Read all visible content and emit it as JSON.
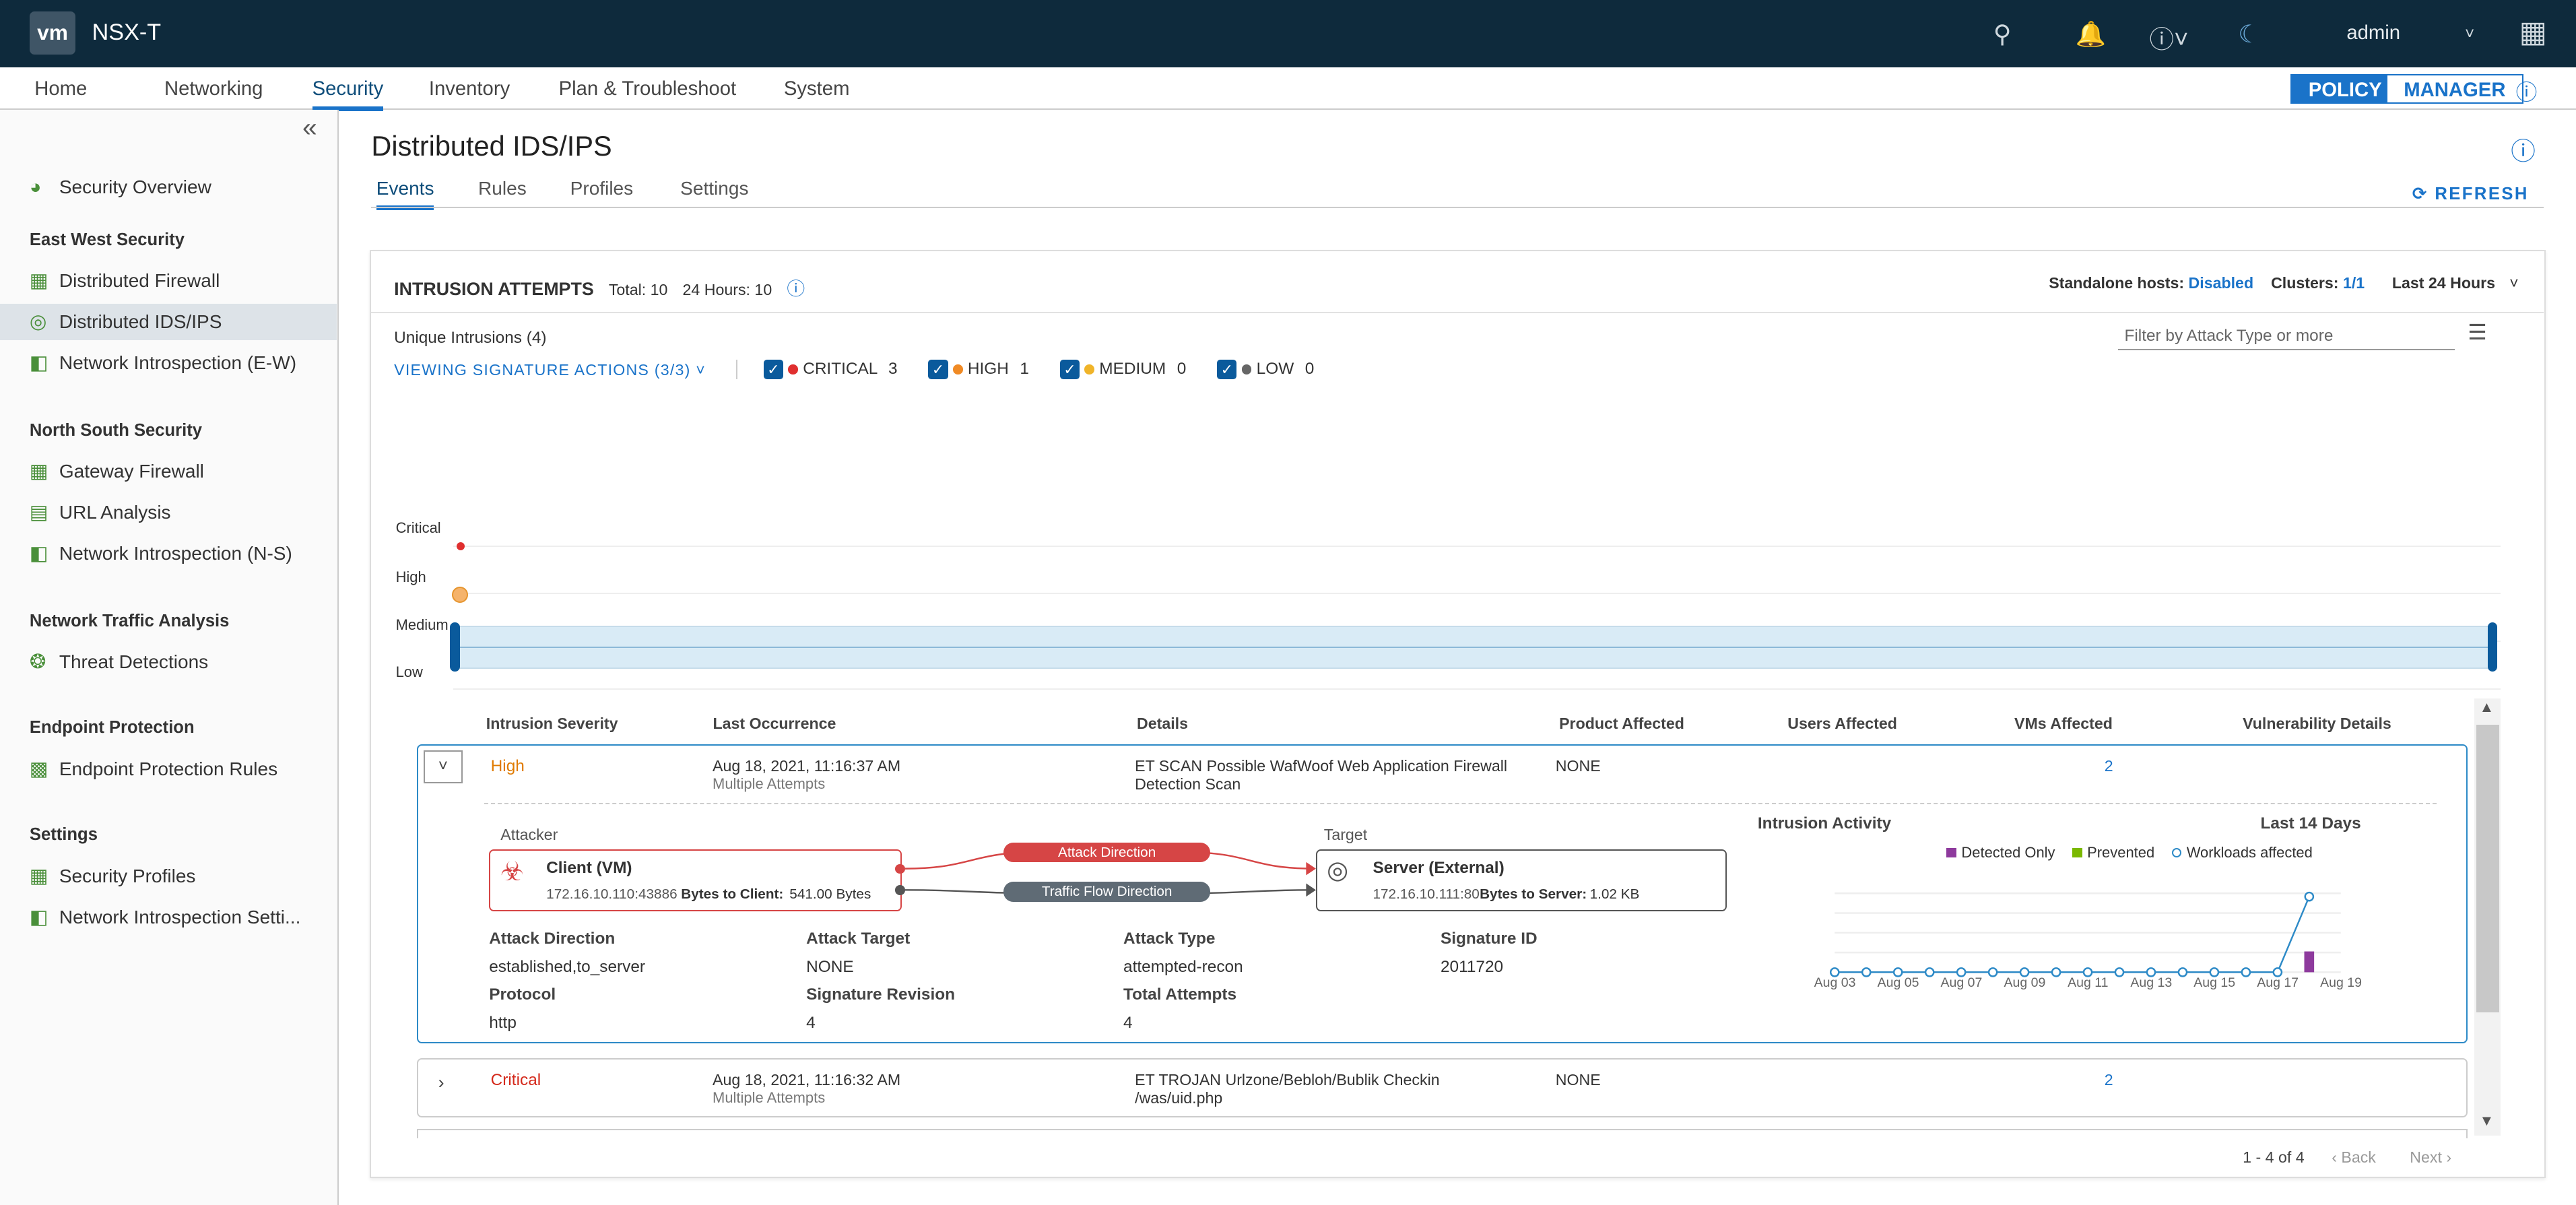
{
  "app": {
    "logo": "vm",
    "product": "NSX-T",
    "user": "admin"
  },
  "nav": {
    "items": [
      "Home",
      "Networking",
      "Security",
      "Inventory",
      "Plan & Troubleshoot",
      "System"
    ],
    "active": "Security",
    "mode_policy": "POLICY",
    "mode_manager": "MANAGER"
  },
  "sidebar": {
    "collapse_icon": "«",
    "items": [
      {
        "type": "item",
        "label": "Security Overview",
        "icon": "gauge-icon"
      },
      {
        "type": "head",
        "label": "East West Security"
      },
      {
        "type": "item",
        "label": "Distributed Firewall",
        "icon": "firewall-icon"
      },
      {
        "type": "item",
        "label": "Distributed IDS/IPS",
        "icon": "ids-icon",
        "selected": true
      },
      {
        "type": "item",
        "label": "Network Introspection (E-W)",
        "icon": "introspection-icon"
      },
      {
        "type": "head",
        "label": "North South Security"
      },
      {
        "type": "item",
        "label": "Gateway Firewall",
        "icon": "firewall-icon"
      },
      {
        "type": "item",
        "label": "URL Analysis",
        "icon": "url-icon"
      },
      {
        "type": "item",
        "label": "Network Introspection (N-S)",
        "icon": "introspection-icon"
      },
      {
        "type": "head",
        "label": "Network Traffic Analysis"
      },
      {
        "type": "item",
        "label": "Threat Detections",
        "icon": "threat-icon"
      },
      {
        "type": "head",
        "label": "Endpoint Protection"
      },
      {
        "type": "item",
        "label": "Endpoint Protection Rules",
        "icon": "endpoint-icon"
      },
      {
        "type": "head",
        "label": "Settings"
      },
      {
        "type": "item",
        "label": "Security Profiles",
        "icon": "profile-icon"
      },
      {
        "type": "item",
        "label": "Network Introspection Setti...",
        "icon": "introspection-icon"
      }
    ]
  },
  "page": {
    "title": "Distributed IDS/IPS",
    "tabs": [
      "Events",
      "Rules",
      "Profiles",
      "Settings"
    ],
    "active_tab": "Events",
    "refresh": "REFRESH"
  },
  "intrusions": {
    "title": "INTRUSION ATTEMPTS",
    "total": "Total: 10",
    "hours": "24 Hours: 10",
    "standalone_label": "Standalone hosts:",
    "standalone_value": "Disabled",
    "clusters_label": "Clusters:",
    "clusters_value": "1/1",
    "time_range": "Last 24 Hours",
    "unique": "Unique Intrusions (4)",
    "filter_placeholder": "Filter by Attack Type or more",
    "viewing": "VIEWING SIGNATURE ACTIONS (3/3)",
    "filters": [
      {
        "label": "CRITICAL",
        "count": "3",
        "color": "#e02f2f"
      },
      {
        "label": "HIGH",
        "count": "1",
        "color": "#f08a24"
      },
      {
        "label": "MEDIUM",
        "count": "0",
        "color": "#f0b429"
      },
      {
        "label": "LOW",
        "count": "0",
        "color": "#666666"
      }
    ],
    "severity_axis": [
      "Critical",
      "High",
      "Medium",
      "Low"
    ]
  },
  "table": {
    "columns": [
      "Intrusion Severity",
      "Last Occurrence",
      "Details",
      "Product Affected",
      "Users Affected",
      "VMs Affected",
      "Vulnerability Details"
    ],
    "rows": [
      {
        "severity": "High",
        "severity_color": "#e07b00",
        "occurrence": "Aug 18, 2021, 11:16:37 AM",
        "attempts": "Multiple Attempts",
        "details_1": "ET SCAN Possible WafWoof Web Application Firewall",
        "details_2": "Detection Scan",
        "product": "NONE",
        "vms": "2"
      },
      {
        "severity": "Critical",
        "severity_color": "#d42a1c",
        "occurrence": "Aug 18, 2021, 11:16:32 AM",
        "attempts": "Multiple Attempts",
        "details_1": "ET TROJAN Urlzone/Bebloh/Bublik Checkin",
        "details_2": "/was/uid.php",
        "product": "NONE",
        "vms": "2"
      }
    ],
    "pagination": {
      "range": "1 - 4 of 4",
      "back": "Back",
      "next": "Next"
    }
  },
  "detail": {
    "attacker_label": "Attacker",
    "attacker_name": "Client (VM)",
    "attacker_ip": "172.16.10.110:43886",
    "attacker_bytes_label": "Bytes to Client:",
    "attacker_bytes": "541.00 Bytes",
    "target_label": "Target",
    "target_name": "Server (External)",
    "target_ip": "172.16.10.111:80",
    "target_bytes_label": "Bytes to Server:",
    "target_bytes": "1.02 KB",
    "attack_direction_pill": "Attack Direction",
    "traffic_direction_pill": "Traffic Flow Direction",
    "fields": [
      {
        "label": "Attack Direction",
        "value": "established,to_server"
      },
      {
        "label": "Attack Target",
        "value": "NONE"
      },
      {
        "label": "Attack Type",
        "value": "attempted-recon"
      },
      {
        "label": "Signature ID",
        "value": "2011720"
      },
      {
        "label": "Protocol",
        "value": "http"
      },
      {
        "label": "Signature Revision",
        "value": "4"
      },
      {
        "label": "Total Attempts",
        "value": "4"
      }
    ],
    "activity_title": "Intrusion Activity",
    "activity_range": "Last 14 Days",
    "legend": [
      {
        "label": "Detected Only",
        "color": "#8e3a9d"
      },
      {
        "label": "Prevented",
        "color": "#7ab800"
      },
      {
        "label": "Workloads affected",
        "color": "#2d8ac7"
      }
    ]
  },
  "chart_data": {
    "type": "line",
    "x": [
      "Aug 03",
      "Aug 04",
      "Aug 05",
      "Aug 06",
      "Aug 07",
      "Aug 08",
      "Aug 09",
      "Aug 10",
      "Aug 11",
      "Aug 12",
      "Aug 13",
      "Aug 14",
      "Aug 15",
      "Aug 16",
      "Aug 17",
      "Aug 18",
      "Aug 19"
    ],
    "xtick_labels": [
      "Aug 03",
      "Aug 05",
      "Aug 07",
      "Aug 09",
      "Aug 11",
      "Aug 13",
      "Aug 15",
      "Aug 17",
      "Aug 19"
    ],
    "series": [
      {
        "name": "Workloads affected",
        "values": [
          0,
          0,
          0,
          0,
          0,
          0,
          0,
          0,
          0,
          0,
          0,
          0,
          0,
          0,
          0,
          2,
          null
        ]
      },
      {
        "name": "Detected Only",
        "values": [
          0,
          0,
          0,
          0,
          0,
          0,
          0,
          0,
          0,
          0,
          0,
          0,
          0,
          0,
          0,
          1,
          null
        ]
      }
    ],
    "ylim": [
      0,
      2
    ]
  }
}
